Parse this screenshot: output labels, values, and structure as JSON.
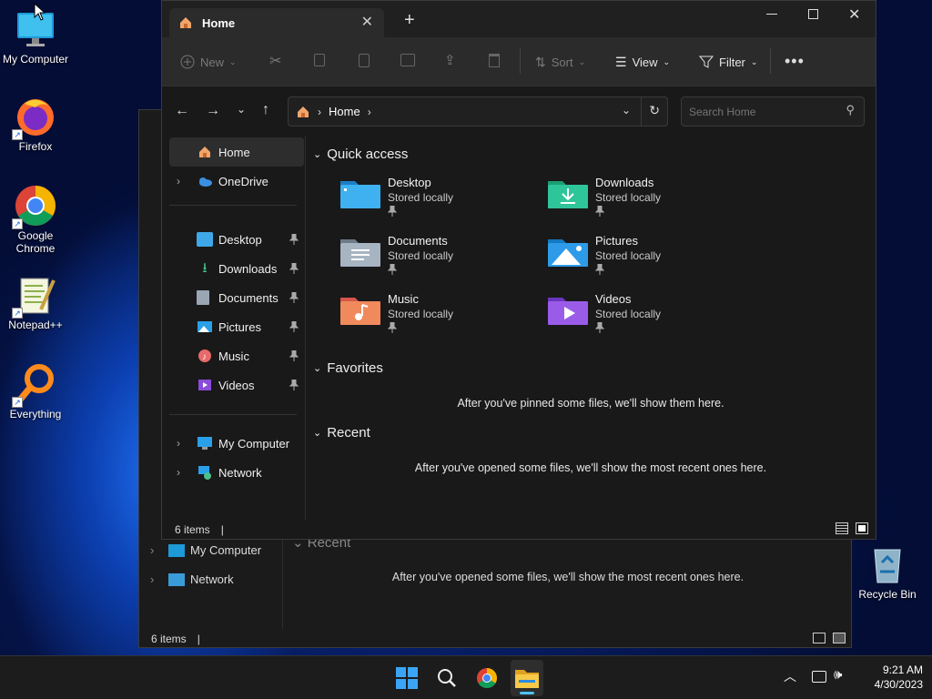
{
  "desktop": {
    "icons": [
      {
        "label": "My Computer"
      },
      {
        "label": "Firefox"
      },
      {
        "label": "Google Chrome"
      },
      {
        "label": "Notepad++"
      },
      {
        "label": "Everything"
      },
      {
        "label": "Recycle Bin"
      }
    ]
  },
  "back_window": {
    "nav": {
      "my_computer": "My Computer",
      "network": "Network"
    },
    "section_recent": "Recent",
    "recent_msg": "After you've opened some files, we'll show the most recent ones here.",
    "status": "6 items"
  },
  "explorer": {
    "tab_title": "Home",
    "toolbar": {
      "new": "New",
      "sort": "Sort",
      "view": "View",
      "filter": "Filter"
    },
    "address": {
      "segment": "Home"
    },
    "search": {
      "placeholder": "Search Home"
    },
    "nav": {
      "home": "Home",
      "onedrive": "OneDrive",
      "desktop": "Desktop",
      "downloads": "Downloads",
      "documents": "Documents",
      "pictures": "Pictures",
      "music": "Music",
      "videos": "Videos",
      "my_computer": "My Computer",
      "network": "Network"
    },
    "quick_access": {
      "title": "Quick access",
      "items": [
        {
          "name": "Desktop",
          "sub": "Stored locally"
        },
        {
          "name": "Downloads",
          "sub": "Stored locally"
        },
        {
          "name": "Documents",
          "sub": "Stored locally"
        },
        {
          "name": "Pictures",
          "sub": "Stored locally"
        },
        {
          "name": "Music",
          "sub": "Stored locally"
        },
        {
          "name": "Videos",
          "sub": "Stored locally"
        }
      ]
    },
    "favorites": {
      "title": "Favorites",
      "msg": "After you've pinned some files, we'll show them here."
    },
    "recent": {
      "title": "Recent",
      "msg": "After you've opened some files, we'll show the most recent ones here."
    },
    "status": "6 items"
  },
  "taskbar": {
    "time": "9:21 AM",
    "date": "4/30/2023"
  },
  "colors": {
    "accent": "#0078d4",
    "window_bg": "#191919",
    "taskbar_bg": "#1c1c1c"
  }
}
